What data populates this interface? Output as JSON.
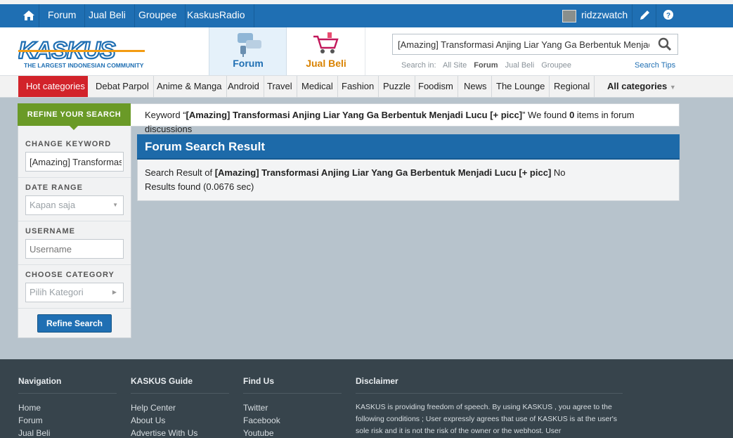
{
  "topbar": {
    "links": [
      "Forum",
      "Jual Beli",
      "Groupee",
      "KaskusRadio"
    ],
    "username": "ridzzwatch",
    "home_icon": "home-icon",
    "edit_icon": "pencil-icon",
    "help_icon": "help-icon"
  },
  "header": {
    "logo_text": "KASKUS",
    "logo_tagline": "THE LARGEST INDONESIAN COMMUNITY",
    "nav_forum": "Forum",
    "nav_jualbeli": "Jual Beli",
    "search_value": "[Amazing] Transformasi Anjing Liar Yang Ga Berbentuk Menjadi Lucu [+ picc]",
    "search_in_label": "Search in:",
    "search_scopes": [
      "All Site",
      "Forum",
      "Jual Beli",
      "Groupee"
    ],
    "search_scope_active": "Forum",
    "search_tips": "Search Tips"
  },
  "categories": {
    "hot": "Hot categories",
    "items": [
      "Debat Parpol",
      "Anime & Manga",
      "Android",
      "Travel",
      "Medical",
      "Fashion",
      "Puzzle",
      "Foodism",
      "News",
      "The Lounge",
      "Regional"
    ],
    "all": "All categories"
  },
  "sidebar": {
    "title": "REFINE YOUR SEARCH",
    "change_keyword_label": "CHANGE KEYWORD",
    "keyword_value": "[Amazing] Transformasi Anjing Liar Yang Ga Berbentuk Menjadi Lucu [+ picc]",
    "date_range_label": "DATE RANGE",
    "date_range_value": "Kapan saja",
    "username_label": "USERNAME",
    "username_placeholder": "Username",
    "category_label": "CHOOSE CATEGORY",
    "category_value": "Pilih Kategori",
    "refine_button": "Refine Search"
  },
  "keyword_bar": {
    "prefix": "Keyword “",
    "keyword": "[Amazing] Transformasi Anjing Liar Yang Ga Berbentuk Menjadi Lucu [+ picc]",
    "middle": "” We found ",
    "count": "0",
    "suffix": " items in forum discussions"
  },
  "result": {
    "title": "Forum Search Result",
    "prefix": "Search Result of ",
    "keyword": "[Amazing] Transformasi Anjing Liar Yang Ga Berbentuk Menjadi Lucu [+ picc]",
    "suffix": " No Results found (0.0676 sec)"
  },
  "footer": {
    "nav_title": "Navigation",
    "nav_links": [
      "Home",
      "Forum",
      "Jual Beli"
    ],
    "guide_title": "KASKUS Guide",
    "guide_links": [
      "Help Center",
      "About Us",
      "Advertise With Us"
    ],
    "find_title": "Find Us",
    "find_links": [
      "Twitter",
      "Facebook",
      "Youtube"
    ],
    "disclaimer_title": "Disclaimer",
    "disclaimer_text": "KASKUS is providing freedom of speech. By using KASKUS , you agree to the following conditions ; User expressly agrees that use of KASKUS is at the user's sole risk and it is not the risk of the owner or the webhost. User"
  }
}
